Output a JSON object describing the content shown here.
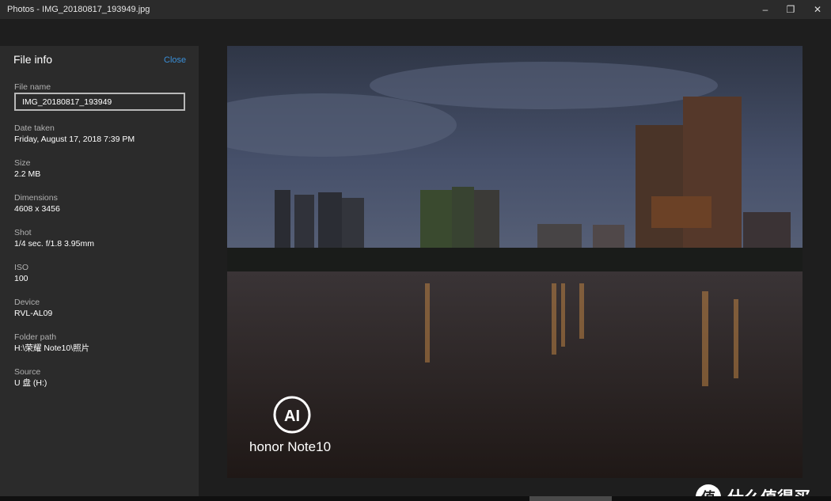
{
  "window": {
    "title": "Photos - IMG_20180817_193949.jpg",
    "minimize_glyph": "–",
    "maximize_glyph": "❐",
    "close_glyph": "✕"
  },
  "info_panel": {
    "header": "File info",
    "close_label": "Close",
    "file_name_label": "File name",
    "file_name_value": "IMG_20180817_193949",
    "date_label": "Date taken",
    "date_value": "Friday, August 17, 2018 7:39 PM",
    "size_label": "Size",
    "size_value": "2.2 MB",
    "dimensions_label": "Dimensions",
    "dimensions_value": "4608 x 3456",
    "shot_label": "Shot",
    "shot_value": "1/4 sec. f/1.8 3.95mm",
    "iso_label": "ISO",
    "iso_value": "100",
    "device_label": "Device",
    "device_value": "RVL-AL09",
    "folder_label": "Folder path",
    "folder_value": "H:\\荣耀 Note10\\照片",
    "source_label": "Source",
    "source_value": "U 盘 (H:)"
  },
  "photo": {
    "logo_mark": "AI",
    "brand_text": "honor Note10",
    "sky_color": "#3a4356",
    "water_color": "#2b2320"
  },
  "watermark": {
    "icon_glyph": "值",
    "text": "什么值得买"
  }
}
